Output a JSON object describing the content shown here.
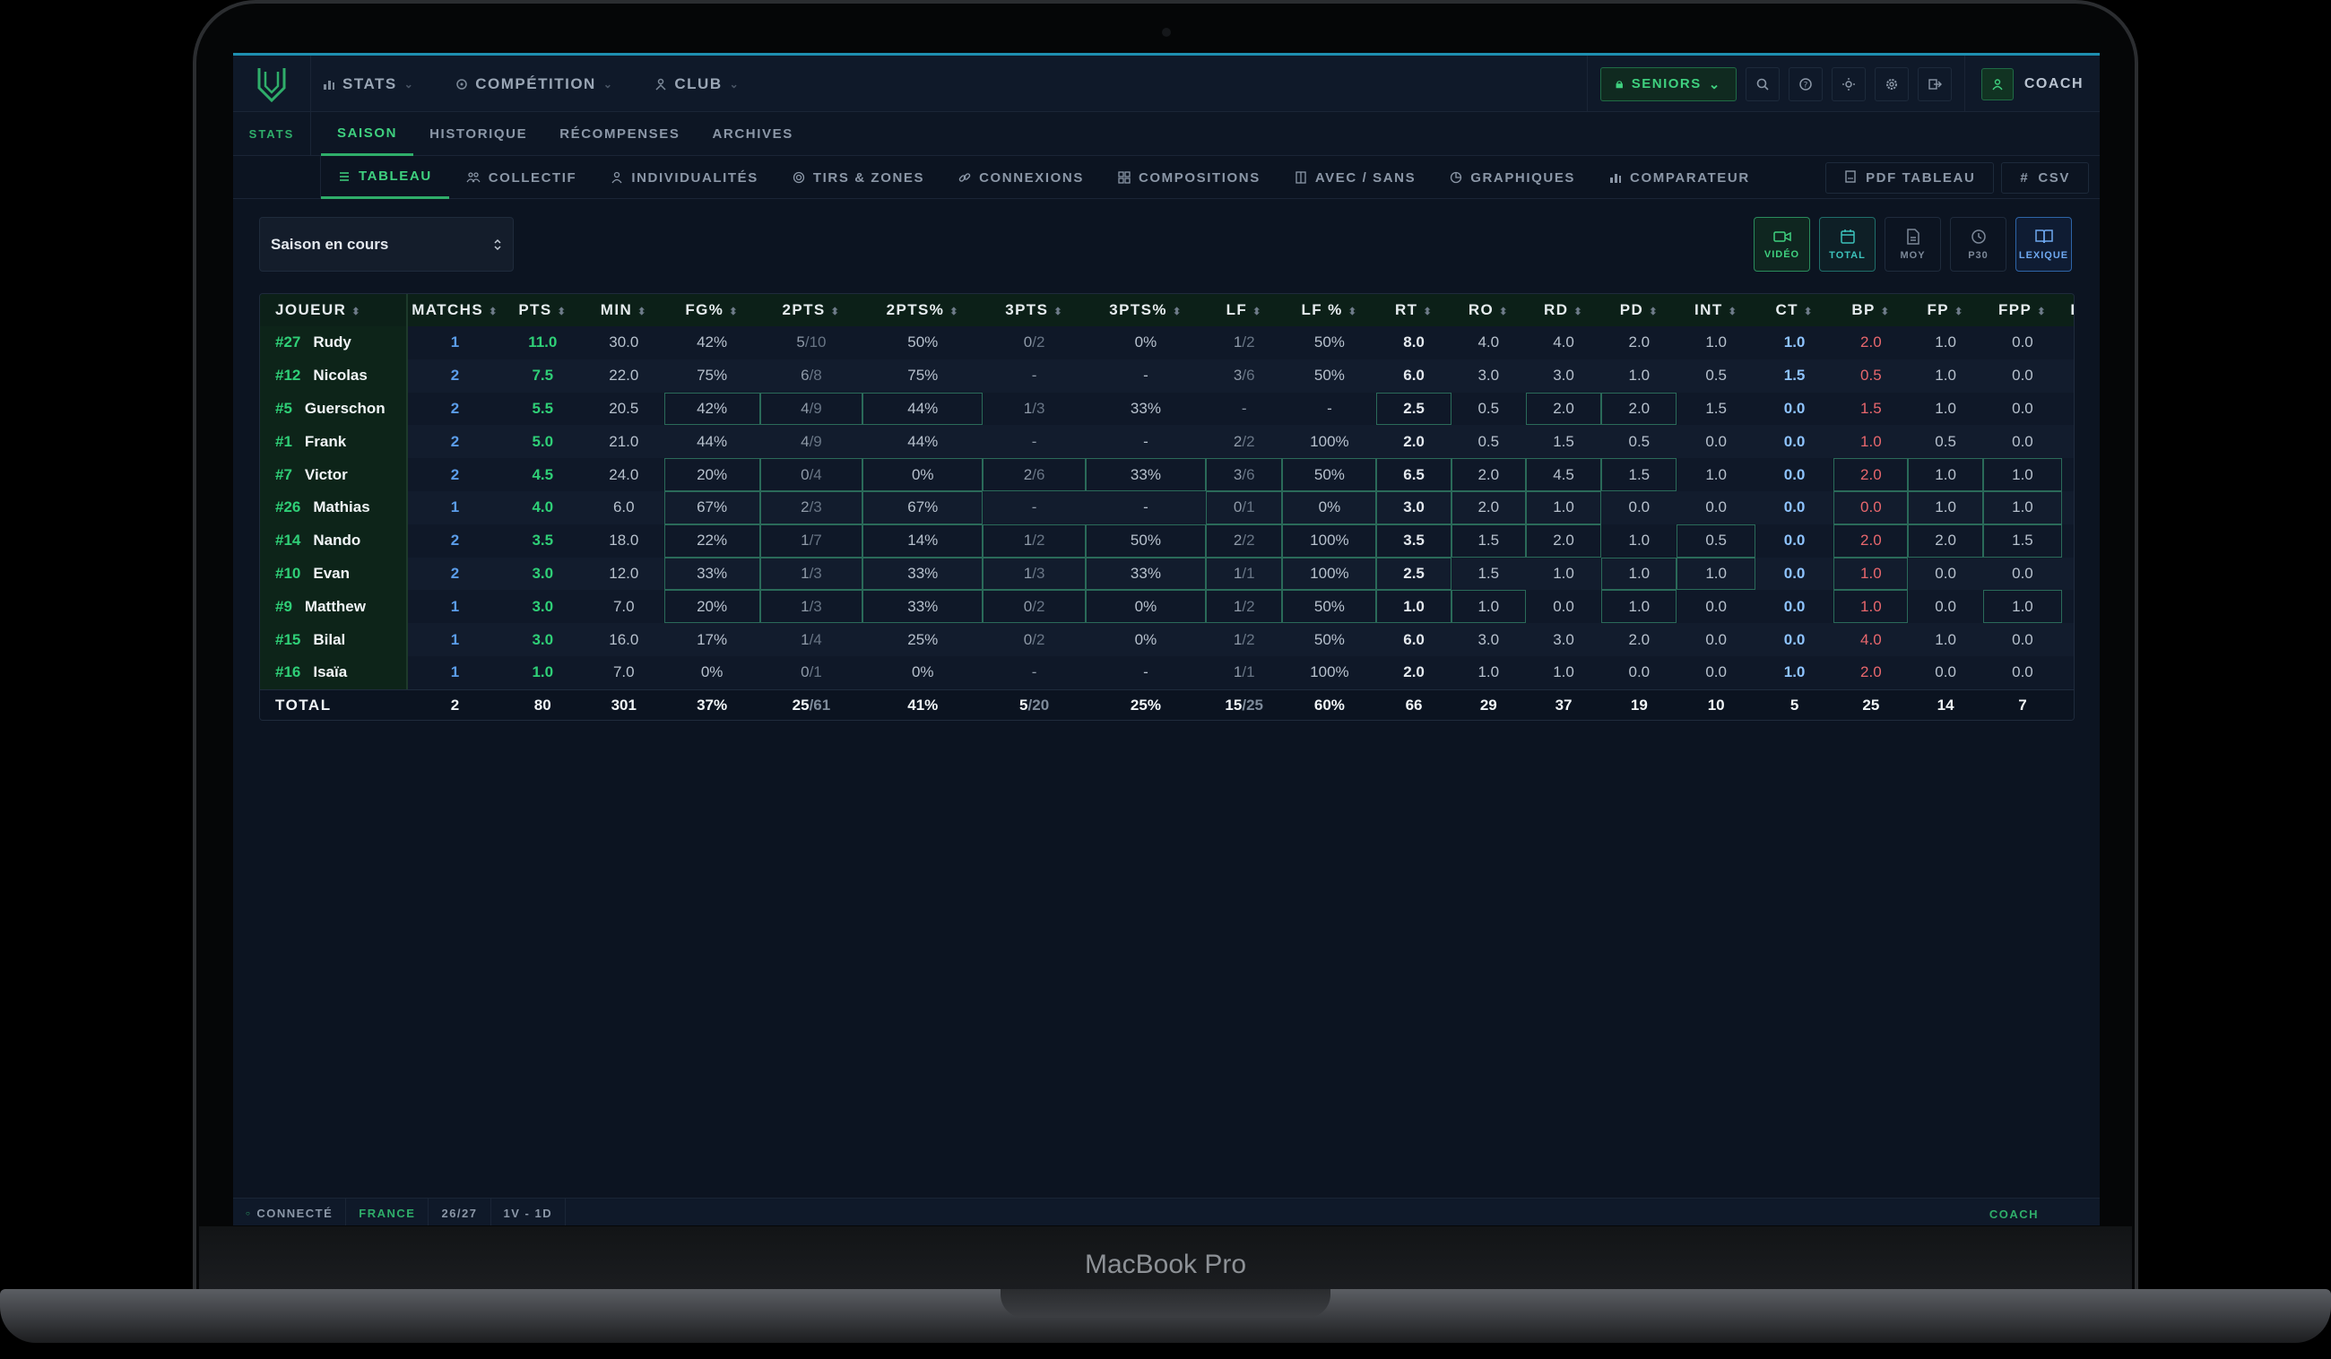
{
  "device_label": "MacBook Pro",
  "topnav": {
    "items": [
      {
        "label": "STATS",
        "icon": "bar-chart-icon"
      },
      {
        "label": "COMPÉTITION",
        "icon": "trophy-icon"
      },
      {
        "label": "CLUB",
        "icon": "people-icon"
      }
    ],
    "team_selector": "SENIORS",
    "user_label": "COACH"
  },
  "section_label": "STATS",
  "subnav": [
    "SAISON",
    "HISTORIQUE",
    "RÉCOMPENSES",
    "ARCHIVES"
  ],
  "subnav_active": 0,
  "views": [
    {
      "label": "TABLEAU",
      "icon": "list-icon"
    },
    {
      "label": "COLLECTIF",
      "icon": "team-icon"
    },
    {
      "label": "INDIVIDUALITÉS",
      "icon": "user-icon"
    },
    {
      "label": "TIRS & ZONES",
      "icon": "target-icon"
    },
    {
      "label": "CONNEXIONS",
      "icon": "link-icon"
    },
    {
      "label": "COMPOSITIONS",
      "icon": "grid-icon"
    },
    {
      "label": "AVEC / SANS",
      "icon": "columns-icon"
    },
    {
      "label": "GRAPHIQUES",
      "icon": "pie-chart-icon"
    },
    {
      "label": "COMPARATEUR",
      "icon": "bar-chart-icon"
    }
  ],
  "views_active": 0,
  "exports": {
    "pdf": "PDF TABLEAU",
    "csv": "CSV"
  },
  "season_select": {
    "value": "Saison en cours"
  },
  "view_buttons": [
    {
      "label": "VIDÉO",
      "icon": "video-icon",
      "state": "green"
    },
    {
      "label": "TOTAL",
      "icon": "calendar-icon",
      "state": "teal"
    },
    {
      "label": "MOY",
      "icon": "document-icon",
      "state": "off"
    },
    {
      "label": "P30",
      "icon": "clock-icon",
      "state": "off"
    },
    {
      "label": "LEXIQUE",
      "icon": "book-icon",
      "state": "blue"
    }
  ],
  "table": {
    "columns": [
      "JOUEUR",
      "MATCHS",
      "PTS",
      "MIN",
      "FG%",
      "2PTS",
      "2PTS%",
      "3PTS",
      "3PTS%",
      "LF",
      "LF %",
      "RT",
      "RO",
      "RD",
      "PD",
      "INT",
      "CT",
      "BP",
      "FP",
      "FPP",
      "ÉV"
    ],
    "rows": [
      {
        "num": "#27",
        "name": "Rudy",
        "v": [
          "1",
          "11.0",
          "30.0",
          "42%",
          "5/10",
          "50%",
          "0/2",
          "0%",
          "1/2",
          "50%",
          "8.0",
          "4.0",
          "4.0",
          "2.0",
          "1.0",
          "1.0",
          "2.0",
          "1.0",
          "0.0"
        ],
        "hl": []
      },
      {
        "num": "#12",
        "name": "Nicolas",
        "v": [
          "2",
          "7.5",
          "22.0",
          "75%",
          "6/8",
          "75%",
          "-",
          "-",
          "3/6",
          "50%",
          "6.0",
          "3.0",
          "3.0",
          "1.0",
          "0.5",
          "1.5",
          "0.5",
          "1.0",
          "0.0"
        ],
        "hl": []
      },
      {
        "num": "#5",
        "name": "Guerschon",
        "v": [
          "2",
          "5.5",
          "20.5",
          "42%",
          "4/9",
          "44%",
          "1/3",
          "33%",
          "-",
          "-",
          "2.5",
          "0.5",
          "2.0",
          "2.0",
          "1.5",
          "0.0",
          "1.5",
          "1.0",
          "0.0"
        ],
        "hl": [
          3,
          4,
          5,
          10,
          12,
          13
        ]
      },
      {
        "num": "#1",
        "name": "Frank",
        "v": [
          "2",
          "5.0",
          "21.0",
          "44%",
          "4/9",
          "44%",
          "-",
          "-",
          "2/2",
          "100%",
          "2.0",
          "0.5",
          "1.5",
          "0.5",
          "0.0",
          "0.0",
          "1.0",
          "0.5",
          "0.0"
        ],
        "hl": []
      },
      {
        "num": "#7",
        "name": "Victor",
        "v": [
          "2",
          "4.5",
          "24.0",
          "20%",
          "0/4",
          "0%",
          "2/6",
          "33%",
          "3/6",
          "50%",
          "6.5",
          "2.0",
          "4.5",
          "1.5",
          "1.0",
          "0.0",
          "2.0",
          "1.0",
          "1.0"
        ],
        "hl": [
          3,
          4,
          5,
          6,
          7,
          8,
          9,
          10,
          11,
          12,
          13,
          16,
          17,
          18
        ]
      },
      {
        "num": "#26",
        "name": "Mathias",
        "v": [
          "1",
          "4.0",
          "6.0",
          "67%",
          "2/3",
          "67%",
          "-",
          "-",
          "0/1",
          "0%",
          "3.0",
          "2.0",
          "1.0",
          "0.0",
          "0.0",
          "0.0",
          "0.0",
          "1.0",
          "1.0"
        ],
        "hl": [
          3,
          4,
          5,
          8,
          9,
          10,
          11,
          12,
          16,
          17,
          18
        ]
      },
      {
        "num": "#14",
        "name": "Nando",
        "v": [
          "2",
          "3.5",
          "18.0",
          "22%",
          "1/7",
          "14%",
          "1/2",
          "50%",
          "2/2",
          "100%",
          "3.5",
          "1.5",
          "2.0",
          "1.0",
          "0.5",
          "0.0",
          "2.0",
          "2.0",
          "1.5"
        ],
        "hl": [
          3,
          4,
          5,
          6,
          7,
          8,
          9,
          10,
          11,
          12,
          14,
          16,
          17,
          18
        ]
      },
      {
        "num": "#10",
        "name": "Evan",
        "v": [
          "2",
          "3.0",
          "12.0",
          "33%",
          "1/3",
          "33%",
          "1/3",
          "33%",
          "1/1",
          "100%",
          "2.5",
          "1.5",
          "1.0",
          "1.0",
          "1.0",
          "0.0",
          "1.0",
          "0.0",
          "0.0"
        ],
        "hl": [
          3,
          4,
          5,
          6,
          7,
          8,
          9,
          10,
          13,
          14,
          16
        ]
      },
      {
        "num": "#9",
        "name": "Matthew",
        "v": [
          "1",
          "3.0",
          "7.0",
          "20%",
          "1/3",
          "33%",
          "0/2",
          "0%",
          "1/2",
          "50%",
          "1.0",
          "1.0",
          "0.0",
          "1.0",
          "0.0",
          "0.0",
          "1.0",
          "0.0",
          "1.0"
        ],
        "hl": [
          3,
          4,
          5,
          6,
          7,
          8,
          9,
          10,
          11,
          13,
          16,
          18
        ]
      },
      {
        "num": "#15",
        "name": "Bilal",
        "v": [
          "1",
          "3.0",
          "16.0",
          "17%",
          "1/4",
          "25%",
          "0/2",
          "0%",
          "1/2",
          "50%",
          "6.0",
          "3.0",
          "3.0",
          "2.0",
          "0.0",
          "0.0",
          "4.0",
          "1.0",
          "0.0"
        ],
        "hl": []
      },
      {
        "num": "#16",
        "name": "Isaïa",
        "v": [
          "1",
          "1.0",
          "7.0",
          "0%",
          "0/1",
          "0%",
          "-",
          "-",
          "1/1",
          "100%",
          "2.0",
          "1.0",
          "1.0",
          "0.0",
          "0.0",
          "1.0",
          "2.0",
          "0.0",
          "0.0"
        ],
        "hl": []
      }
    ],
    "total": {
      "label": "TOTAL",
      "v": [
        "2",
        "80",
        "301",
        "37%",
        "25/61",
        "41%",
        "5/20",
        "25%",
        "15/25",
        "60%",
        "66",
        "29",
        "37",
        "19",
        "10",
        "5",
        "25",
        "14",
        "7"
      ]
    }
  },
  "status": {
    "connection": "CONNECTÉ",
    "country": "FRANCE",
    "season": "26/27",
    "record": "1V - 1D",
    "role": "COACH"
  }
}
